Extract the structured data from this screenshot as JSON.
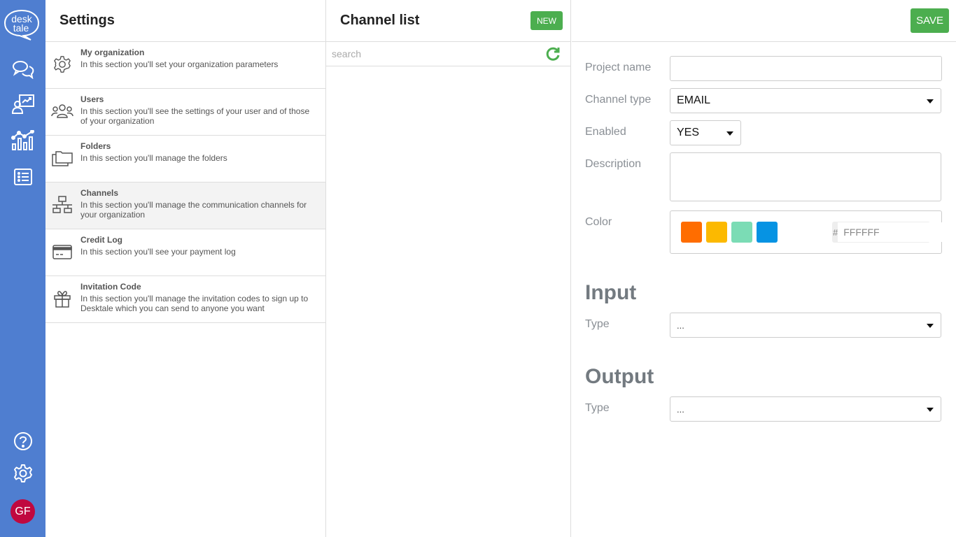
{
  "rail": {
    "logo_line1": "desk",
    "logo_line2": "tale",
    "nav_icons": [
      "chat-icon",
      "presentation-icon",
      "analytics-icon",
      "list-icon"
    ],
    "bottom_icons": [
      "help-icon",
      "gear-icon"
    ],
    "avatar_initials": "GF",
    "brand_color": "#4f7ed0",
    "avatar_color": "#c0083f"
  },
  "settings": {
    "title": "Settings",
    "items": [
      {
        "icon": "gear-icon",
        "title": "My organization",
        "desc": "In this section you'll set your organization parameters",
        "active": false
      },
      {
        "icon": "users-icon",
        "title": "Users",
        "desc": "In this section you'll see the settings of your user and of those of your organization",
        "active": false
      },
      {
        "icon": "folders-icon",
        "title": "Folders",
        "desc": "In this section you'll manage the folders",
        "active": false
      },
      {
        "icon": "network-icon",
        "title": "Channels",
        "desc": "In this section you'll manage the communication channels for your organization",
        "active": true
      },
      {
        "icon": "credit-card-icon",
        "title": "Credit Log",
        "desc": "In this section you'll see your payment log",
        "active": false
      },
      {
        "icon": "gift-icon",
        "title": "Invitation Code",
        "desc": "In this section you'll manage the invitation codes to sign up to Desktale which you can send to anyone you want",
        "active": false
      }
    ]
  },
  "channel_list": {
    "title": "Channel list",
    "new_label": "NEW",
    "search_placeholder": "search",
    "search_value": "",
    "items": []
  },
  "form": {
    "save_label": "SAVE",
    "project_name": {
      "label": "Project name",
      "value": ""
    },
    "channel_type": {
      "label": "Channel type",
      "value": "EMAIL"
    },
    "enabled": {
      "label": "Enabled",
      "value": "YES"
    },
    "description": {
      "label": "Description",
      "value": ""
    },
    "color": {
      "label": "Color",
      "swatches": [
        "#ff6d00",
        "#fcb900",
        "#7bdcb5",
        "#0693e3"
      ],
      "hash": "#",
      "hex_value": "FFFFFF"
    },
    "input_section": {
      "title": "Input",
      "type_label": "Type",
      "type_value": "..."
    },
    "output_section": {
      "title": "Output",
      "type_label": "Type",
      "type_value": "..."
    },
    "accent_color": "#4cae4f"
  }
}
